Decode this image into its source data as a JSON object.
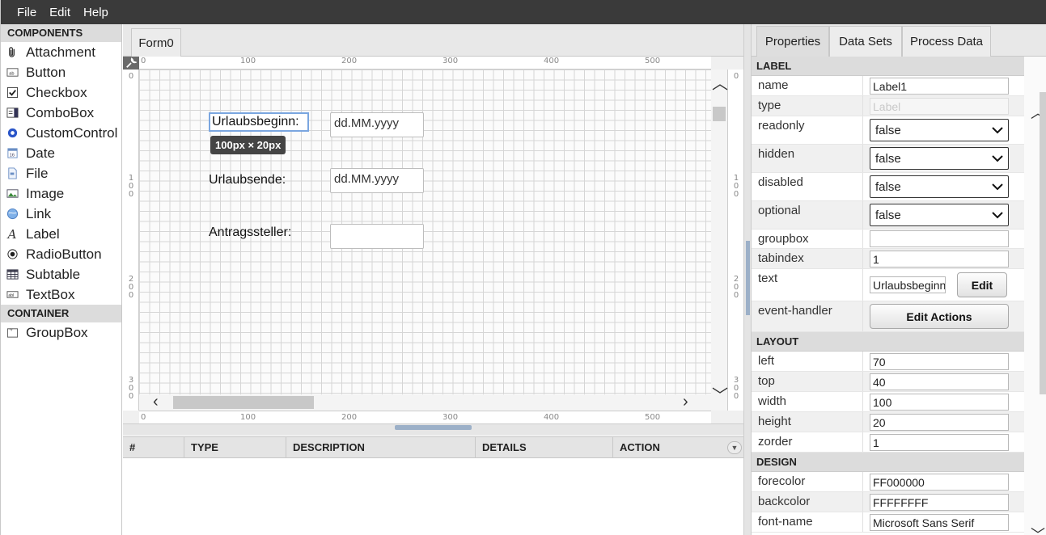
{
  "menu": {
    "items": [
      "File",
      "Edit",
      "Help"
    ]
  },
  "palette": {
    "components_header": "COMPONENTS",
    "components": [
      {
        "label": "Attachment",
        "icon": "paperclip-icon"
      },
      {
        "label": "Button",
        "icon": "button-icon"
      },
      {
        "label": "Checkbox",
        "icon": "checkbox-icon"
      },
      {
        "label": "ComboBox",
        "icon": "combobox-icon"
      },
      {
        "label": "CustomControl",
        "icon": "gear-icon"
      },
      {
        "label": "Date",
        "icon": "calendar-icon"
      },
      {
        "label": "File",
        "icon": "file-icon"
      },
      {
        "label": "Image",
        "icon": "image-icon"
      },
      {
        "label": "Link",
        "icon": "globe-icon"
      },
      {
        "label": "Label",
        "icon": "label-icon"
      },
      {
        "label": "RadioButton",
        "icon": "radio-icon"
      },
      {
        "label": "Subtable",
        "icon": "table-icon"
      },
      {
        "label": "TextBox",
        "icon": "textbox-icon"
      }
    ],
    "container_header": "CONTAINER",
    "containers": [
      {
        "label": "GroupBox",
        "icon": "groupbox-icon"
      }
    ]
  },
  "designer": {
    "form_tab": "Form0",
    "ruler_labels": [
      "0",
      "100",
      "200",
      "300",
      "400",
      "500"
    ],
    "ruler_v_labels": [
      "0",
      "1\n0\n0",
      "2\n0\n0",
      "3\n0\n0"
    ],
    "labels": {
      "urlaubsbeginn": "Urlaubsbeginn:",
      "urlaubsende": "Urlaubsende:",
      "antragssteller": "Antragssteller:"
    },
    "inputs": {
      "urlaubsbeginn_date": "dd.MM.yyyy",
      "urlaubsende_date": "dd.MM.yyyy",
      "antragssteller": ""
    },
    "size_tooltip": "100px × 20px"
  },
  "log_table": {
    "columns": [
      "#",
      "TYPE",
      "DESCRIPTION",
      "DETAILS",
      "ACTION"
    ]
  },
  "right_tabs": [
    "Properties",
    "Data Sets",
    "Process Data"
  ],
  "properties": {
    "label_section": "LABEL",
    "name": {
      "label": "name",
      "value": "Label1"
    },
    "type": {
      "label": "type",
      "value": "Label"
    },
    "readonly": {
      "label": "readonly",
      "value": "false"
    },
    "hidden": {
      "label": "hidden",
      "value": "false"
    },
    "disabled": {
      "label": "disabled",
      "value": "false"
    },
    "optional": {
      "label": "optional",
      "value": "false"
    },
    "groupbox": {
      "label": "groupbox",
      "value": ""
    },
    "tabindex": {
      "label": "tabindex",
      "value": "1"
    },
    "text": {
      "label": "text",
      "value": "Urlaubsbeginn:",
      "button": "Edit"
    },
    "event_handler": {
      "label": "event-handler",
      "button": "Edit Actions"
    },
    "layout_section": "LAYOUT",
    "left": {
      "label": "left",
      "value": "70"
    },
    "top": {
      "label": "top",
      "value": "40"
    },
    "width": {
      "label": "width",
      "value": "100"
    },
    "height": {
      "label": "height",
      "value": "20"
    },
    "zorder": {
      "label": "zorder",
      "value": "1"
    },
    "design_section": "DESIGN",
    "forecolor": {
      "label": "forecolor",
      "value": "FF000000"
    },
    "backcolor": {
      "label": "backcolor",
      "value": "FFFFFFFF"
    },
    "font_name": {
      "label": "font-name",
      "value": "Microsoft Sans Serif"
    }
  },
  "colors": {
    "menubar": "#3a3a3a",
    "selection": "#7aa6e0",
    "splitter_grip": "#9cb0c8"
  }
}
